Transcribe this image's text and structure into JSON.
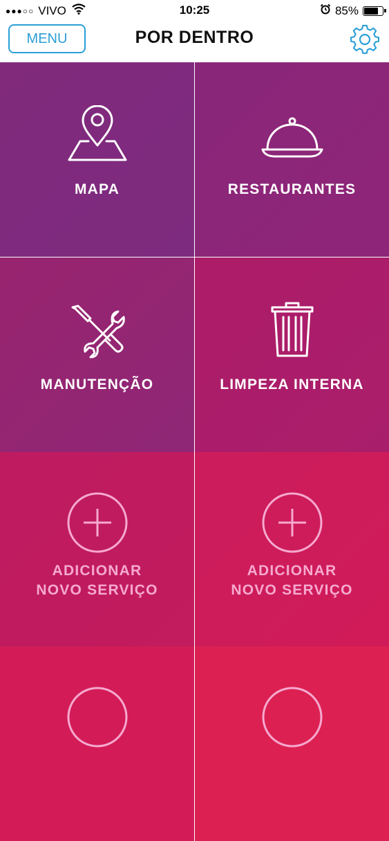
{
  "status_bar": {
    "signal_dots": "●●●○○",
    "carrier": "VIVO",
    "time": "10:25",
    "battery": "85%",
    "battery_level": 0.85,
    "icons": [
      "wifi-icon",
      "alarm-icon",
      "battery-icon"
    ]
  },
  "nav": {
    "menu_label": "MENU",
    "title": "POR DENTRO",
    "settings_icon": "gear-icon"
  },
  "colors": {
    "accent": "#2a9fd6",
    "tile_text": "#ffffff",
    "add_tile_text": "#f6a9cf"
  },
  "tiles": [
    {
      "label": "MAPA",
      "icon": "map-pin-icon"
    },
    {
      "label": "RESTAURANTES",
      "icon": "cloche-icon"
    },
    {
      "label": "MANUTENÇÃO",
      "icon": "tools-icon"
    },
    {
      "label": "LIMPEZA INTERNA",
      "icon": "trash-icon"
    },
    {
      "label_line1": "ADICIONAR",
      "label_line2": "NOVO SERVIÇO",
      "icon": "plus-circle-icon"
    },
    {
      "label_line1": "ADICIONAR",
      "label_line2": "NOVO SERVIÇO",
      "icon": "plus-circle-icon"
    }
  ]
}
